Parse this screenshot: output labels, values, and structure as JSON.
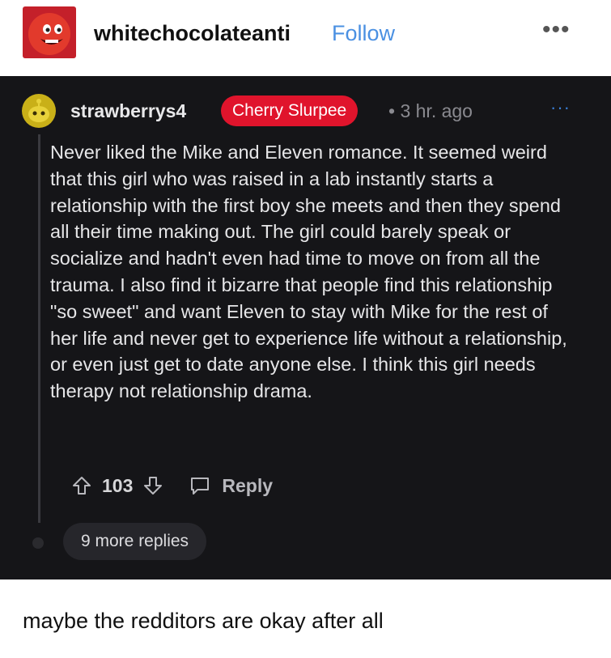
{
  "tumblr_post": {
    "username": "whitechocolateanti",
    "follow_label": "Follow",
    "more_icon": "more-horizontal-icon",
    "caption": "maybe the redditors are okay after all"
  },
  "reddit_comment": {
    "username": "strawberrys4",
    "flair": "Cherry Slurpee",
    "separator": "•",
    "time": "3 hr. ago",
    "more_icon": "more-horizontal-icon",
    "body": "Never liked the Mike and Eleven romance. It seemed weird that this girl who was raised in a lab instantly starts a relationship with the first boy she meets and then they spend all their time making out. The girl could barely speak or socialize and hadn't even had time to move on from all the trauma. I also find it bizarre that people find this relationship \"so sweet\" and want Eleven to stay with Mike for the rest of her life and never get to experience life without a relationship, or even just get to date anyone else. I think this girl needs therapy not relationship drama.",
    "vote_count": "103",
    "reply_label": "Reply",
    "more_replies_label": "9 more replies"
  },
  "colors": {
    "panel_bg": "#151518",
    "flair_bg": "#e0142c",
    "follow_blue": "#4a90e2"
  }
}
